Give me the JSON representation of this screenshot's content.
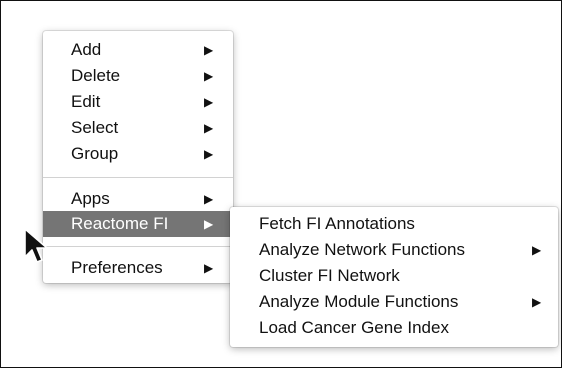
{
  "main_menu": {
    "items": [
      {
        "label": "Add",
        "arrow": "▶"
      },
      {
        "label": "Delete",
        "arrow": "▶"
      },
      {
        "label": "Edit",
        "arrow": "▶"
      },
      {
        "label": "Select",
        "arrow": "▶"
      },
      {
        "label": "Group",
        "arrow": "▶"
      },
      {
        "label": "Apps",
        "arrow": "▶"
      },
      {
        "label": "Reactome FI",
        "arrow": "▶"
      },
      {
        "label": "Preferences",
        "arrow": "▶"
      }
    ],
    "highlighted_item": "Reactome FI"
  },
  "submenu": {
    "items": [
      {
        "label": "Fetch FI Annotations",
        "arrow": ""
      },
      {
        "label": "Analyze Network Functions",
        "arrow": "▶"
      },
      {
        "label": "Cluster FI Network",
        "arrow": ""
      },
      {
        "label": "Analyze Module Functions",
        "arrow": "▶"
      },
      {
        "label": "Load Cancer Gene Index",
        "arrow": ""
      }
    ]
  },
  "colors": {
    "highlight": "#757575",
    "separator": "#d2d2d2",
    "text": "#111111"
  },
  "cursor_icon": "mouse-pointer-icon"
}
